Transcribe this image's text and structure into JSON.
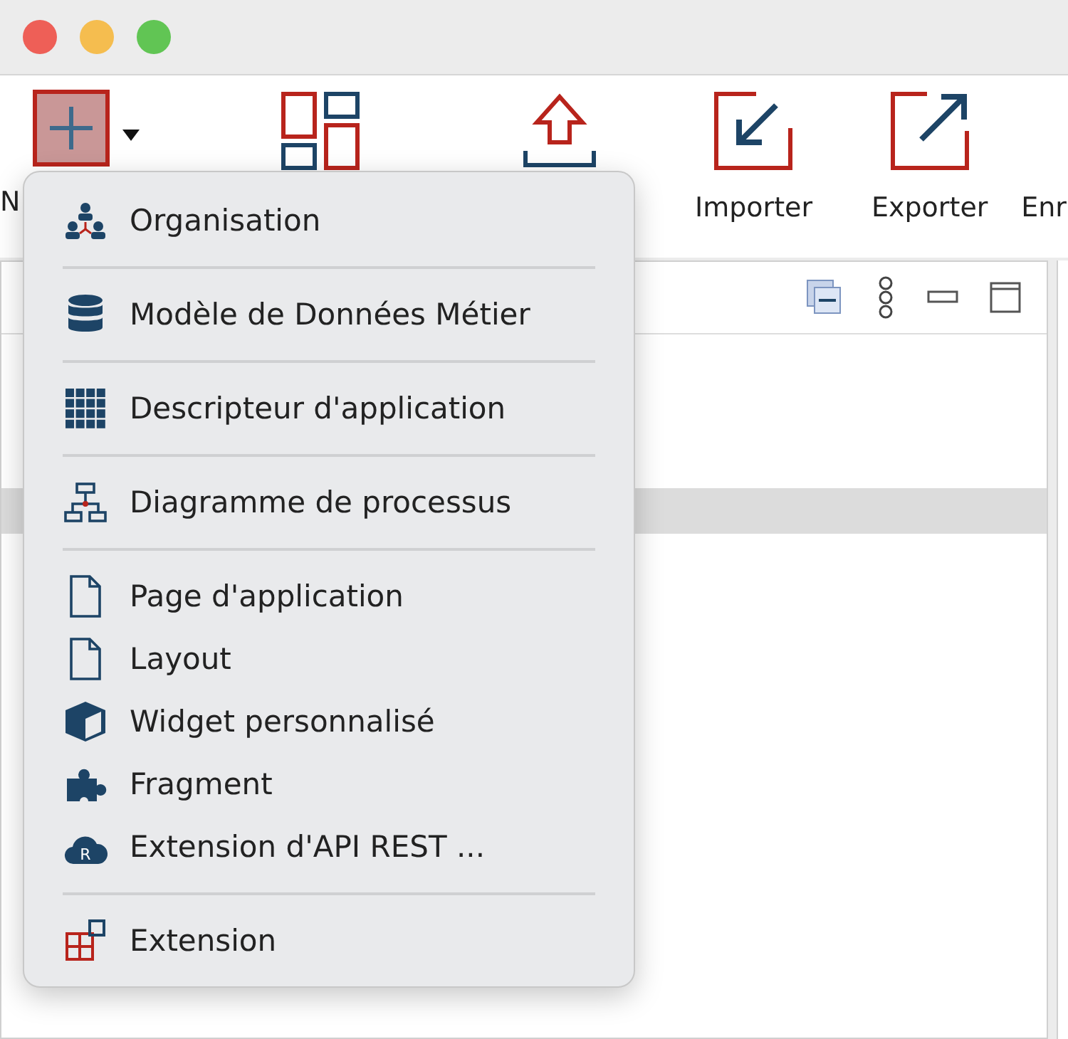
{
  "toolbar": {
    "new_button": {
      "pressed": true
    },
    "items": [
      {
        "kind": "new",
        "label": "N"
      },
      {
        "kind": "tiles"
      },
      {
        "kind": "upload"
      },
      {
        "kind": "import",
        "label": "Importer"
      },
      {
        "kind": "export",
        "label": "Exporter"
      },
      {
        "kind": "plain",
        "label": "Enr"
      }
    ]
  },
  "panel": {
    "highlighted_row": true
  },
  "menu": [
    {
      "kind": "org",
      "label": "Organisation"
    },
    {
      "kind": "separator"
    },
    {
      "kind": "db",
      "label": "Modèle de Données Métier"
    },
    {
      "kind": "separator"
    },
    {
      "kind": "grid",
      "label": "Descripteur d'application"
    },
    {
      "kind": "separator"
    },
    {
      "kind": "flow",
      "label": "Diagramme de processus"
    },
    {
      "kind": "separator"
    },
    {
      "kind": "page",
      "label": "Page d'application"
    },
    {
      "kind": "page",
      "label": "Layout"
    },
    {
      "kind": "cube",
      "label": "Widget personnalisé"
    },
    {
      "kind": "puzzle",
      "label": "Fragment"
    },
    {
      "kind": "cloud",
      "badge": "R",
      "label": "Extension d'API REST ..."
    },
    {
      "kind": "separator"
    },
    {
      "kind": "ext",
      "label": "Extension"
    }
  ]
}
